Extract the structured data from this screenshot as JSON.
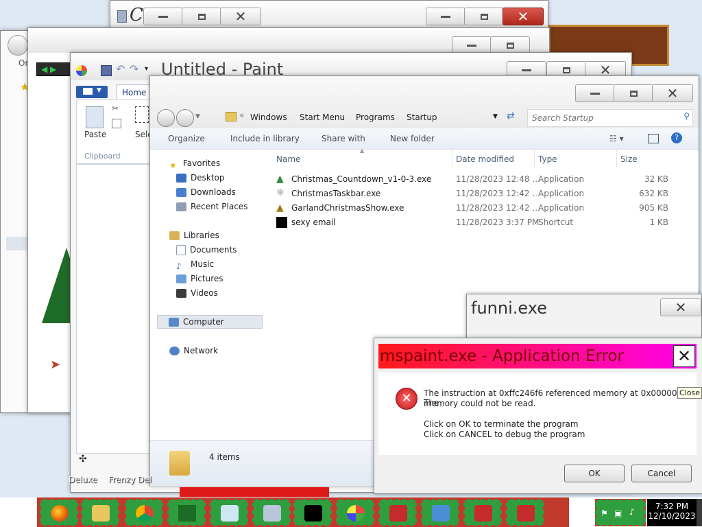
{
  "paint": {
    "title": "Untitled - Paint",
    "tab_home": "Home",
    "paste_label": "Paste",
    "select_label": "Sele",
    "clipboard_group": "Clipboard"
  },
  "back_window": {
    "title_fragment": "C"
  },
  "explorer": {
    "breadcrumb": [
      "Windows",
      "Start Menu",
      "Programs",
      "Startup"
    ],
    "search_placeholder": "Search Startup",
    "commands": {
      "organize": "Organize",
      "include": "Include in library",
      "share": "Share with",
      "new_folder": "New folder"
    },
    "nav": {
      "favorites": "Favorites",
      "desktop": "Desktop",
      "downloads": "Downloads",
      "recent": "Recent Places",
      "libraries": "Libraries",
      "documents": "Documents",
      "music": "Music",
      "pictures": "Pictures",
      "videos": "Videos",
      "computer": "Computer",
      "network": "Network"
    },
    "columns": {
      "name": "Name",
      "date": "Date modified",
      "type": "Type",
      "size": "Size"
    },
    "files": [
      {
        "name": "Christmas_Countdown_v1-0-3.exe",
        "date": "11/28/2023 12:48 ...",
        "type": "Application",
        "size": "32 KB"
      },
      {
        "name": "ChristmasTaskbar.exe",
        "date": "11/28/2023 12:42 ...",
        "type": "Application",
        "size": "632 KB"
      },
      {
        "name": "GarlandChristmasShow.exe",
        "date": "11/28/2023 12:42 ...",
        "type": "Application",
        "size": "905 KB"
      },
      {
        "name": "sexy email",
        "date": "11/28/2023 3:37 PM",
        "type": "Shortcut",
        "size": "1 KB"
      }
    ],
    "status": "4 items"
  },
  "funni": {
    "title": "funni.exe"
  },
  "error_dialog": {
    "title": "mspaint.exe - Application Error",
    "message_line1": "The instruction at 0xffc246f6 referenced memory at 0x00000008. The",
    "message_line2": "memory could not be read.",
    "action_line1": "Click on OK to terminate the program",
    "action_line2": "Click on CANCEL to debug the program",
    "ok": "OK",
    "cancel": "Cancel",
    "tooltip": "Close"
  },
  "desktop_labels": {
    "label1": "Deluxe",
    "label2": "Frenzy Del"
  },
  "clock": {
    "time": "7:32 PM",
    "date": "12/10/2023"
  },
  "colors": {
    "error_red": "#ff1a1a",
    "error_magenta": "#ff00ee",
    "taskbar_green": "#2e9e3e",
    "taskbar_dash": "#cc3333"
  }
}
